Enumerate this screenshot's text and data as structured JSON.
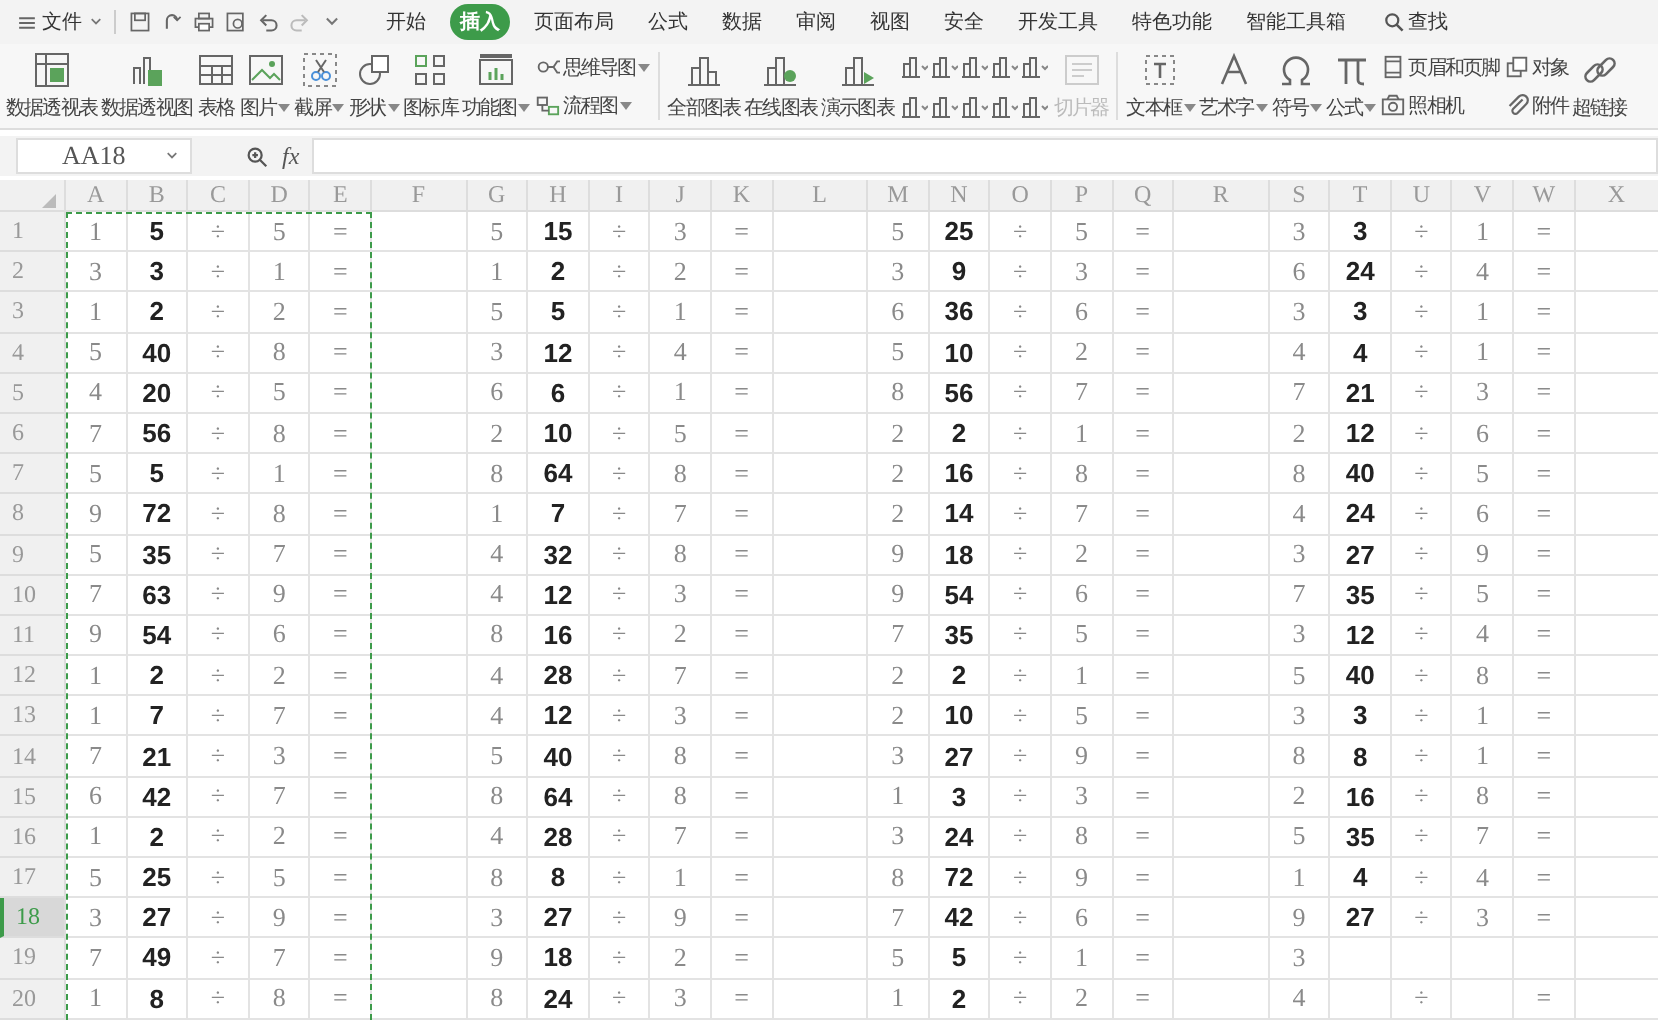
{
  "menu": {
    "file": "文件",
    "tabs": [
      {
        "label": "开始",
        "selected": false
      },
      {
        "label": "插入",
        "selected": true
      },
      {
        "label": "页面布局",
        "selected": false
      },
      {
        "label": "公式",
        "selected": false
      },
      {
        "label": "数据",
        "selected": false
      },
      {
        "label": "审阅",
        "selected": false
      },
      {
        "label": "视图",
        "selected": false
      },
      {
        "label": "安全",
        "selected": false
      },
      {
        "label": "开发工具",
        "selected": false
      },
      {
        "label": "特色功能",
        "selected": false
      },
      {
        "label": "智能工具箱",
        "selected": false
      }
    ],
    "search": "查找"
  },
  "ribbon": {
    "items": [
      {
        "kind": "large",
        "label": "数据透视表",
        "dropdown": false,
        "disabled": false
      },
      {
        "kind": "large",
        "label": "数据透视图",
        "dropdown": false,
        "disabled": false
      },
      {
        "kind": "large",
        "label": "表格",
        "dropdown": false,
        "disabled": false
      },
      {
        "kind": "large",
        "label": "图片",
        "dropdown": true,
        "disabled": false
      },
      {
        "kind": "large",
        "label": "截屏",
        "dropdown": true,
        "disabled": false
      },
      {
        "kind": "large",
        "label": "形状",
        "dropdown": true,
        "disabled": false
      },
      {
        "kind": "large",
        "label": "图标库",
        "dropdown": false,
        "disabled": false
      },
      {
        "kind": "large",
        "label": "功能图",
        "dropdown": true,
        "disabled": false
      },
      {
        "kind": "stack",
        "items": [
          {
            "label": "思维导图",
            "dropdown": true
          },
          {
            "label": "流程图",
            "dropdown": true
          }
        ]
      },
      {
        "kind": "separator"
      },
      {
        "kind": "large",
        "label": "全部图表",
        "dropdown": false,
        "disabled": false
      },
      {
        "kind": "large",
        "label": "在线图表",
        "dropdown": false,
        "disabled": false
      },
      {
        "kind": "large",
        "label": "演示图表",
        "dropdown": false,
        "disabled": false
      },
      {
        "kind": "chart_grid"
      },
      {
        "kind": "large",
        "label": "切片器",
        "dropdown": false,
        "disabled": true
      },
      {
        "kind": "separator"
      },
      {
        "kind": "large",
        "label": "文本框",
        "dropdown": true,
        "disabled": false
      },
      {
        "kind": "large",
        "label": "艺术字",
        "dropdown": true,
        "disabled": false
      },
      {
        "kind": "large",
        "label": "符号",
        "dropdown": true,
        "disabled": false
      },
      {
        "kind": "large",
        "label": "公式",
        "dropdown": true,
        "disabled": false
      },
      {
        "kind": "stack",
        "items": [
          {
            "label": "页眉和页脚",
            "dropdown": false
          },
          {
            "label": "照相机",
            "dropdown": false
          }
        ]
      },
      {
        "kind": "stack",
        "items": [
          {
            "label": "对象",
            "dropdown": false
          },
          {
            "label": "附件",
            "dropdown": false
          }
        ]
      },
      {
        "kind": "large",
        "label": "超链接",
        "dropdown": false,
        "disabled": false
      }
    ]
  },
  "formula_bar": {
    "name_box": "AA18",
    "fx": "fx"
  },
  "sheet": {
    "columns": [
      {
        "label": "A",
        "in_copy_range": true
      },
      {
        "label": "B",
        "in_copy_range": true
      },
      {
        "label": "C",
        "in_copy_range": true
      },
      {
        "label": "D",
        "in_copy_range": true
      },
      {
        "label": "E",
        "in_copy_range": true
      },
      {
        "label": "F",
        "in_copy_range": false
      },
      {
        "label": "G",
        "in_copy_range": false
      },
      {
        "label": "H",
        "in_copy_range": false
      },
      {
        "label": "I",
        "in_copy_range": false
      },
      {
        "label": "J",
        "in_copy_range": false
      },
      {
        "label": "K",
        "in_copy_range": false
      },
      {
        "label": "L",
        "in_copy_range": false
      },
      {
        "label": "M",
        "in_copy_range": false
      },
      {
        "label": "N",
        "in_copy_range": false
      },
      {
        "label": "O",
        "in_copy_range": false
      },
      {
        "label": "P",
        "in_copy_range": false
      },
      {
        "label": "Q",
        "in_copy_range": false
      },
      {
        "label": "R",
        "in_copy_range": false
      },
      {
        "label": "S",
        "in_copy_range": false
      },
      {
        "label": "T",
        "in_copy_range": false
      },
      {
        "label": "U",
        "in_copy_range": false
      },
      {
        "label": "V",
        "in_copy_range": false
      },
      {
        "label": "W",
        "in_copy_range": false
      },
      {
        "label": "X",
        "in_copy_range": false
      }
    ],
    "rows": [
      {
        "header": "1",
        "selected": false,
        "blocks": [
          {
            "answer": "1",
            "dividend": "5",
            "sign": "÷",
            "divisor": "5",
            "equals": "="
          },
          {
            "answer": "5",
            "dividend": "15",
            "sign": "÷",
            "divisor": "3",
            "equals": "="
          },
          {
            "answer": "5",
            "dividend": "25",
            "sign": "÷",
            "divisor": "5",
            "equals": "="
          },
          {
            "answer": "3",
            "dividend": "3",
            "sign": "÷",
            "divisor": "1",
            "equals": "="
          }
        ]
      },
      {
        "header": "2",
        "selected": false,
        "blocks": [
          {
            "answer": "3",
            "dividend": "3",
            "sign": "÷",
            "divisor": "1",
            "equals": "="
          },
          {
            "answer": "1",
            "dividend": "2",
            "sign": "÷",
            "divisor": "2",
            "equals": "="
          },
          {
            "answer": "3",
            "dividend": "9",
            "sign": "÷",
            "divisor": "3",
            "equals": "="
          },
          {
            "answer": "6",
            "dividend": "24",
            "sign": "÷",
            "divisor": "4",
            "equals": "="
          }
        ]
      },
      {
        "header": "3",
        "selected": false,
        "blocks": [
          {
            "answer": "1",
            "dividend": "2",
            "sign": "÷",
            "divisor": "2",
            "equals": "="
          },
          {
            "answer": "5",
            "dividend": "5",
            "sign": "÷",
            "divisor": "1",
            "equals": "="
          },
          {
            "answer": "6",
            "dividend": "36",
            "sign": "÷",
            "divisor": "6",
            "equals": "="
          },
          {
            "answer": "3",
            "dividend": "3",
            "sign": "÷",
            "divisor": "1",
            "equals": "="
          }
        ]
      },
      {
        "header": "4",
        "selected": false,
        "blocks": [
          {
            "answer": "5",
            "dividend": "40",
            "sign": "÷",
            "divisor": "8",
            "equals": "="
          },
          {
            "answer": "3",
            "dividend": "12",
            "sign": "÷",
            "divisor": "4",
            "equals": "="
          },
          {
            "answer": "5",
            "dividend": "10",
            "sign": "÷",
            "divisor": "2",
            "equals": "="
          },
          {
            "answer": "4",
            "dividend": "4",
            "sign": "÷",
            "divisor": "1",
            "equals": "="
          }
        ]
      },
      {
        "header": "5",
        "selected": false,
        "blocks": [
          {
            "answer": "4",
            "dividend": "20",
            "sign": "÷",
            "divisor": "5",
            "equals": "="
          },
          {
            "answer": "6",
            "dividend": "6",
            "sign": "÷",
            "divisor": "1",
            "equals": "="
          },
          {
            "answer": "8",
            "dividend": "56",
            "sign": "÷",
            "divisor": "7",
            "equals": "="
          },
          {
            "answer": "7",
            "dividend": "21",
            "sign": "÷",
            "divisor": "3",
            "equals": "="
          }
        ]
      },
      {
        "header": "6",
        "selected": false,
        "blocks": [
          {
            "answer": "7",
            "dividend": "56",
            "sign": "÷",
            "divisor": "8",
            "equals": "="
          },
          {
            "answer": "2",
            "dividend": "10",
            "sign": "÷",
            "divisor": "5",
            "equals": "="
          },
          {
            "answer": "2",
            "dividend": "2",
            "sign": "÷",
            "divisor": "1",
            "equals": "="
          },
          {
            "answer": "2",
            "dividend": "12",
            "sign": "÷",
            "divisor": "6",
            "equals": "="
          }
        ]
      },
      {
        "header": "7",
        "selected": false,
        "blocks": [
          {
            "answer": "5",
            "dividend": "5",
            "sign": "÷",
            "divisor": "1",
            "equals": "="
          },
          {
            "answer": "8",
            "dividend": "64",
            "sign": "÷",
            "divisor": "8",
            "equals": "="
          },
          {
            "answer": "2",
            "dividend": "16",
            "sign": "÷",
            "divisor": "8",
            "equals": "="
          },
          {
            "answer": "8",
            "dividend": "40",
            "sign": "÷",
            "divisor": "5",
            "equals": "="
          }
        ]
      },
      {
        "header": "8",
        "selected": false,
        "blocks": [
          {
            "answer": "9",
            "dividend": "72",
            "sign": "÷",
            "divisor": "8",
            "equals": "="
          },
          {
            "answer": "1",
            "dividend": "7",
            "sign": "÷",
            "divisor": "7",
            "equals": "="
          },
          {
            "answer": "2",
            "dividend": "14",
            "sign": "÷",
            "divisor": "7",
            "equals": "="
          },
          {
            "answer": "4",
            "dividend": "24",
            "sign": "÷",
            "divisor": "6",
            "equals": "="
          }
        ]
      },
      {
        "header": "9",
        "selected": false,
        "blocks": [
          {
            "answer": "5",
            "dividend": "35",
            "sign": "÷",
            "divisor": "7",
            "equals": "="
          },
          {
            "answer": "4",
            "dividend": "32",
            "sign": "÷",
            "divisor": "8",
            "equals": "="
          },
          {
            "answer": "9",
            "dividend": "18",
            "sign": "÷",
            "divisor": "2",
            "equals": "="
          },
          {
            "answer": "3",
            "dividend": "27",
            "sign": "÷",
            "divisor": "9",
            "equals": "="
          }
        ]
      },
      {
        "header": "10",
        "selected": false,
        "blocks": [
          {
            "answer": "7",
            "dividend": "63",
            "sign": "÷",
            "divisor": "9",
            "equals": "="
          },
          {
            "answer": "4",
            "dividend": "12",
            "sign": "÷",
            "divisor": "3",
            "equals": "="
          },
          {
            "answer": "9",
            "dividend": "54",
            "sign": "÷",
            "divisor": "6",
            "equals": "="
          },
          {
            "answer": "7",
            "dividend": "35",
            "sign": "÷",
            "divisor": "5",
            "equals": "="
          }
        ]
      },
      {
        "header": "11",
        "selected": false,
        "blocks": [
          {
            "answer": "9",
            "dividend": "54",
            "sign": "÷",
            "divisor": "6",
            "equals": "="
          },
          {
            "answer": "8",
            "dividend": "16",
            "sign": "÷",
            "divisor": "2",
            "equals": "="
          },
          {
            "answer": "7",
            "dividend": "35",
            "sign": "÷",
            "divisor": "5",
            "equals": "="
          },
          {
            "answer": "3",
            "dividend": "12",
            "sign": "÷",
            "divisor": "4",
            "equals": "="
          }
        ]
      },
      {
        "header": "12",
        "selected": false,
        "blocks": [
          {
            "answer": "1",
            "dividend": "2",
            "sign": "÷",
            "divisor": "2",
            "equals": "="
          },
          {
            "answer": "4",
            "dividend": "28",
            "sign": "÷",
            "divisor": "7",
            "equals": "="
          },
          {
            "answer": "2",
            "dividend": "2",
            "sign": "÷",
            "divisor": "1",
            "equals": "="
          },
          {
            "answer": "5",
            "dividend": "40",
            "sign": "÷",
            "divisor": "8",
            "equals": "="
          }
        ]
      },
      {
        "header": "13",
        "selected": false,
        "blocks": [
          {
            "answer": "1",
            "dividend": "7",
            "sign": "÷",
            "divisor": "7",
            "equals": "="
          },
          {
            "answer": "4",
            "dividend": "12",
            "sign": "÷",
            "divisor": "3",
            "equals": "="
          },
          {
            "answer": "2",
            "dividend": "10",
            "sign": "÷",
            "divisor": "5",
            "equals": "="
          },
          {
            "answer": "3",
            "dividend": "3",
            "sign": "÷",
            "divisor": "1",
            "equals": "="
          }
        ]
      },
      {
        "header": "14",
        "selected": false,
        "blocks": [
          {
            "answer": "7",
            "dividend": "21",
            "sign": "÷",
            "divisor": "3",
            "equals": "="
          },
          {
            "answer": "5",
            "dividend": "40",
            "sign": "÷",
            "divisor": "8",
            "equals": "="
          },
          {
            "answer": "3",
            "dividend": "27",
            "sign": "÷",
            "divisor": "9",
            "equals": "="
          },
          {
            "answer": "8",
            "dividend": "8",
            "sign": "÷",
            "divisor": "1",
            "equals": "="
          }
        ]
      },
      {
        "header": "15",
        "selected": false,
        "blocks": [
          {
            "answer": "6",
            "dividend": "42",
            "sign": "÷",
            "divisor": "7",
            "equals": "="
          },
          {
            "answer": "8",
            "dividend": "64",
            "sign": "÷",
            "divisor": "8",
            "equals": "="
          },
          {
            "answer": "1",
            "dividend": "3",
            "sign": "÷",
            "divisor": "3",
            "equals": "="
          },
          {
            "answer": "2",
            "dividend": "16",
            "sign": "÷",
            "divisor": "8",
            "equals": "="
          }
        ]
      },
      {
        "header": "16",
        "selected": false,
        "blocks": [
          {
            "answer": "1",
            "dividend": "2",
            "sign": "÷",
            "divisor": "2",
            "equals": "="
          },
          {
            "answer": "4",
            "dividend": "28",
            "sign": "÷",
            "divisor": "7",
            "equals": "="
          },
          {
            "answer": "3",
            "dividend": "24",
            "sign": "÷",
            "divisor": "8",
            "equals": "="
          },
          {
            "answer": "5",
            "dividend": "35",
            "sign": "÷",
            "divisor": "7",
            "equals": "="
          }
        ]
      },
      {
        "header": "17",
        "selected": false,
        "blocks": [
          {
            "answer": "5",
            "dividend": "25",
            "sign": "÷",
            "divisor": "5",
            "equals": "="
          },
          {
            "answer": "8",
            "dividend": "8",
            "sign": "÷",
            "divisor": "1",
            "equals": "="
          },
          {
            "answer": "8",
            "dividend": "72",
            "sign": "÷",
            "divisor": "9",
            "equals": "="
          },
          {
            "answer": "1",
            "dividend": "4",
            "sign": "÷",
            "divisor": "4",
            "equals": "="
          }
        ]
      },
      {
        "header": "18",
        "selected": true,
        "blocks": [
          {
            "answer": "3",
            "dividend": "27",
            "sign": "÷",
            "divisor": "9",
            "equals": "="
          },
          {
            "answer": "3",
            "dividend": "27",
            "sign": "÷",
            "divisor": "9",
            "equals": "="
          },
          {
            "answer": "7",
            "dividend": "42",
            "sign": "÷",
            "divisor": "6",
            "equals": "="
          },
          {
            "answer": "9",
            "dividend": "27",
            "sign": "÷",
            "divisor": "3",
            "equals": "="
          }
        ]
      },
      {
        "header": "19",
        "selected": false,
        "blocks": [
          {
            "answer": "7",
            "dividend": "49",
            "sign": "÷",
            "divisor": "7",
            "equals": "="
          },
          {
            "answer": "9",
            "dividend": "18",
            "sign": "÷",
            "divisor": "2",
            "equals": "="
          },
          {
            "answer": "5",
            "dividend": "5",
            "sign": "÷",
            "divisor": "1",
            "equals": "="
          },
          {
            "answer": "3"
          }
        ]
      },
      {
        "header": "20",
        "selected": false,
        "blocks": [
          {
            "answer": "1",
            "dividend": "8",
            "sign": "÷",
            "divisor": "8",
            "equals": "="
          },
          {
            "answer": "8",
            "dividend": "24",
            "sign": "÷",
            "divisor": "3",
            "equals": "="
          },
          {
            "answer": "1",
            "dividend": "2",
            "sign": "÷",
            "divisor": "2",
            "equals": "="
          },
          {
            "answer": "4",
            "sign": "÷",
            "equals": "="
          }
        ]
      }
    ]
  }
}
